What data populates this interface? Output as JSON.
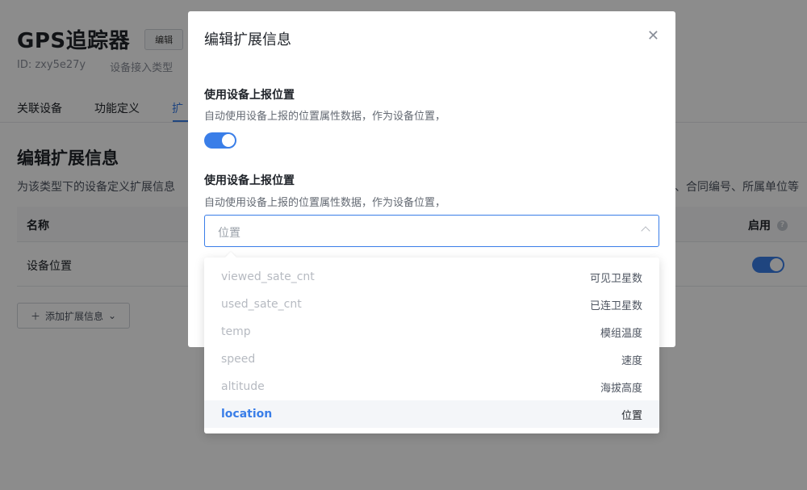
{
  "page": {
    "title": "GPS追踪器",
    "edit_label": "编辑",
    "id_text": "ID: zxy5e27y",
    "access_type_text": "设备接入类型",
    "tabs": [
      {
        "label": "关联设备"
      },
      {
        "label": "功能定义"
      },
      {
        "label": "扩"
      }
    ],
    "section_title": "编辑扩展信息",
    "section_desc_left": "为该类型下的设备定义扩展信息",
    "section_desc_right": "、合同编号、所属单位等",
    "table": {
      "col_name": "名称",
      "col_enable": "启用",
      "rows": [
        {
          "name": "设备位置",
          "enabled": true
        }
      ]
    },
    "add_label": "添加扩展信息",
    "accent_color": "#3a7ee8"
  },
  "modal": {
    "title": "编辑扩展信息",
    "fields": [
      {
        "label": "使用设备上报位置",
        "desc": "自动使用设备上报的位置属性数据，作为设备位置，",
        "toggle_on": true
      },
      {
        "label": "使用设备上报位置",
        "desc": "自动使用设备上报的位置属性数据，作为设备位置，"
      }
    ],
    "select": {
      "value": "位置"
    },
    "options": [
      {
        "key": "viewed_sate_cnt",
        "desc": "可见卫星数"
      },
      {
        "key": "used_sate_cnt",
        "desc": "已连卫星数"
      },
      {
        "key": "temp",
        "desc": "模组温度"
      },
      {
        "key": "speed",
        "desc": "速度"
      },
      {
        "key": "altitude",
        "desc": "海拔高度"
      },
      {
        "key": "location",
        "desc": "位置",
        "selected": true
      }
    ]
  },
  "icons": {
    "close": "close-icon",
    "plus": "plus-icon",
    "chevron": "chevron-down-icon",
    "help": "help-icon"
  }
}
